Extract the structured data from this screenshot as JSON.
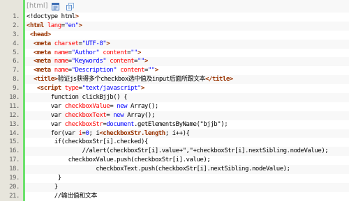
{
  "toolbar": {
    "language_label": "[html]",
    "icons": [
      "view-plain-icon",
      "copy-icon"
    ]
  },
  "theme": {
    "accent": "#6ce26c"
  },
  "code": {
    "lines": [
      {
        "num": "1.",
        "tokens": [
          {
            "t": "<!doctype html"
          },
          {
            "t": ">",
            "c": "#993300",
            "b": true
          }
        ]
      },
      {
        "num": "2.",
        "tokens": [
          {
            "t": "<html",
            "c": "#993300",
            "b": true
          },
          {
            "t": " "
          },
          {
            "t": "lang",
            "c": "#ff0000"
          },
          {
            "t": "="
          },
          {
            "t": "\"en\"",
            "c": "#0000ff"
          },
          {
            "t": ">",
            "c": "#993300",
            "b": true
          }
        ]
      },
      {
        "num": "3.",
        "tokens": [
          {
            "t": " "
          },
          {
            "t": "<head>",
            "c": "#993300",
            "b": true
          }
        ]
      },
      {
        "num": "4.",
        "tokens": [
          {
            "t": "  "
          },
          {
            "t": "<meta",
            "c": "#993300",
            "b": true
          },
          {
            "t": " "
          },
          {
            "t": "charset",
            "c": "#ff0000"
          },
          {
            "t": "="
          },
          {
            "t": "\"UTF-8\"",
            "c": "#0000ff"
          },
          {
            "t": ">",
            "c": "#993300",
            "b": true
          }
        ]
      },
      {
        "num": "5.",
        "tokens": [
          {
            "t": "  "
          },
          {
            "t": "<meta",
            "c": "#993300",
            "b": true
          },
          {
            "t": " "
          },
          {
            "t": "name",
            "c": "#ff0000"
          },
          {
            "t": "="
          },
          {
            "t": "\"Author\"",
            "c": "#0000ff"
          },
          {
            "t": " "
          },
          {
            "t": "content",
            "c": "#ff0000"
          },
          {
            "t": "="
          },
          {
            "t": "\"\"",
            "c": "#0000ff"
          },
          {
            "t": ">",
            "c": "#993300",
            "b": true
          }
        ]
      },
      {
        "num": "6.",
        "tokens": [
          {
            "t": "  "
          },
          {
            "t": "<meta",
            "c": "#993300",
            "b": true
          },
          {
            "t": " "
          },
          {
            "t": "name",
            "c": "#ff0000"
          },
          {
            "t": "="
          },
          {
            "t": "\"Keywords\"",
            "c": "#0000ff"
          },
          {
            "t": " "
          },
          {
            "t": "content",
            "c": "#ff0000"
          },
          {
            "t": "="
          },
          {
            "t": "\"\"",
            "c": "#0000ff"
          },
          {
            "t": ">",
            "c": "#993300",
            "b": true
          }
        ]
      },
      {
        "num": "7.",
        "tokens": [
          {
            "t": "  "
          },
          {
            "t": "<meta",
            "c": "#993300",
            "b": true
          },
          {
            "t": " "
          },
          {
            "t": "name",
            "c": "#ff0000"
          },
          {
            "t": "="
          },
          {
            "t": "\"Description\"",
            "c": "#0000ff"
          },
          {
            "t": " "
          },
          {
            "t": "content",
            "c": "#ff0000"
          },
          {
            "t": "="
          },
          {
            "t": "\"\"",
            "c": "#0000ff"
          },
          {
            "t": ">",
            "c": "#993300",
            "b": true
          }
        ]
      },
      {
        "num": "8.",
        "tokens": [
          {
            "t": "  "
          },
          {
            "t": "<title>",
            "c": "#993300",
            "b": true
          },
          {
            "t": "验证js获得多个checkbox选中值及input后面所跟文本"
          },
          {
            "t": "</title>",
            "c": "#993300",
            "b": true
          }
        ]
      },
      {
        "num": "9.",
        "tokens": [
          {
            "t": "   "
          },
          {
            "t": "<script",
            "c": "#993300",
            "b": true
          },
          {
            "t": " "
          },
          {
            "t": "type",
            "c": "#ff0000"
          },
          {
            "t": "="
          },
          {
            "t": "\"text/javascript\"",
            "c": "#0000ff"
          },
          {
            "t": ">",
            "c": "#993300",
            "b": true
          }
        ]
      },
      {
        "num": "10.",
        "tokens": [
          {
            "t": "       function clickBjjb() {"
          }
        ]
      },
      {
        "num": "11.",
        "tokens": [
          {
            "t": "       var "
          },
          {
            "t": "checkboxValue",
            "c": "#ff0000"
          },
          {
            "t": "= "
          },
          {
            "t": "new",
            "c": "#0000ff"
          },
          {
            "t": " Array();"
          }
        ]
      },
      {
        "num": "12.",
        "tokens": [
          {
            "t": "       var "
          },
          {
            "t": "checkboxText",
            "c": "#ff0000"
          },
          {
            "t": "= "
          },
          {
            "t": "new",
            "c": "#0000ff"
          },
          {
            "t": " Array();"
          }
        ]
      },
      {
        "num": "13.",
        "tokens": [
          {
            "t": "       var "
          },
          {
            "t": "checkboxStr",
            "c": "#ff0000"
          },
          {
            "t": "="
          },
          {
            "t": "document",
            "c": "#0000ff"
          },
          {
            "t": ".getElementsByName(\"bjjb\");"
          }
        ]
      },
      {
        "num": "14.",
        "tokens": [
          {
            "t": "       for(var "
          },
          {
            "t": "i",
            "c": "#ff0000"
          },
          {
            "t": "="
          },
          {
            "t": "0",
            "c": "#0000ff"
          },
          {
            "t": "; i"
          },
          {
            "t": "<checkboxStr.length",
            "c": "#993300",
            "b": true
          },
          {
            "t": "; i++){"
          }
        ]
      },
      {
        "num": "15.",
        "tokens": [
          {
            "t": "        if(checkboxStr[i].checked){"
          }
        ]
      },
      {
        "num": "16.",
        "tokens": [
          {
            "t": "                //alert(checkboxStr[i].value+\",\"+checkboxStr[i].nextSibling.nodeValue);"
          }
        ]
      },
      {
        "num": "17.",
        "tokens": [
          {
            "t": "            checkboxValue.push(checkboxStr[i].value);"
          }
        ]
      },
      {
        "num": "18.",
        "tokens": [
          {
            "t": "                    checkboxText.push(checkboxStr[i].nextSibling.nodeValue);"
          }
        ]
      },
      {
        "num": "19.",
        "tokens": [
          {
            "t": "         }"
          }
        ]
      },
      {
        "num": "20.",
        "tokens": [
          {
            "t": "        }"
          }
        ]
      },
      {
        "num": "21.",
        "tokens": [
          {
            "t": "        //输出值和文本"
          }
        ]
      }
    ]
  }
}
